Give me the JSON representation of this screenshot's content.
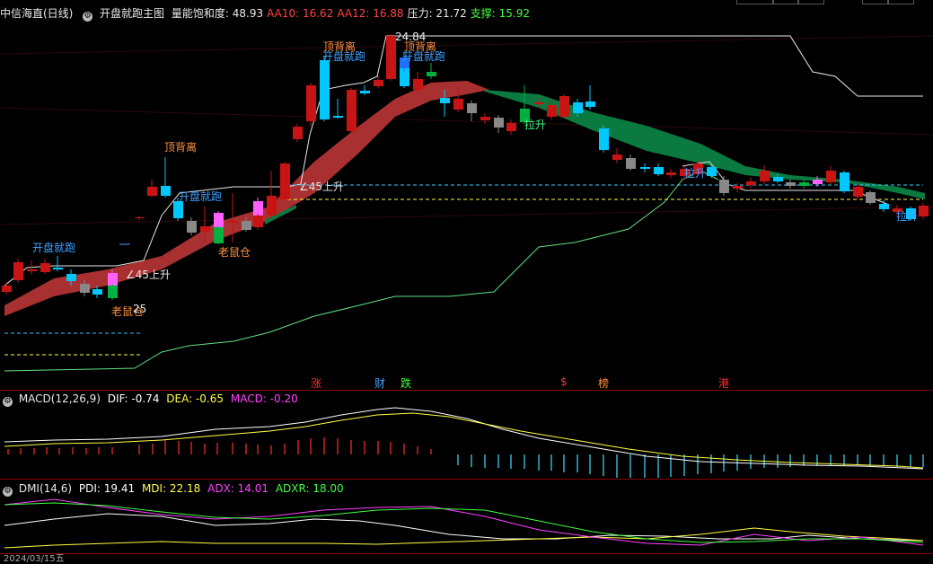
{
  "header": {
    "stock_name": "中信海直(日线)",
    "main_chart_name": "开盘就跑主图",
    "indicators": [
      {
        "label": "量能饱和度: 48.93",
        "color": "#e8e8e8"
      },
      {
        "label": "AA10: 16.62",
        "color": "#ff4040"
      },
      {
        "label": "AA12: 16.88",
        "color": "#ff4040"
      },
      {
        "label": "压力: 21.72",
        "color": "#e8e8e8"
      },
      {
        "label": "支撑: 15.92",
        "color": "#40ff40"
      }
    ]
  },
  "annotations": {
    "open_run_1": "开盘就跑",
    "open_run_2": "开盘就跑",
    "open_run_3": "开盘就跑",
    "open_run_4": "开盘就跑",
    "top_div_1": "顶背离",
    "top_div_2": "顶背离",
    "top_div_3": "顶背离",
    "rise45_1": "∠45上升",
    "rise45_2": "∠45上升",
    "rat_1": "老鼠仓",
    "rat_2": "老鼠仓",
    "pull_1": "拉升",
    "pull_2": "拉升",
    "pull_3": "拉升",
    "high_label": "24.84",
    "low_label": "25"
  },
  "events": [
    {
      "label": "涨",
      "color": "#ff3030"
    },
    {
      "label": "财",
      "color": "#40a0ff"
    },
    {
      "label": "跌",
      "color": "#40ff40"
    },
    {
      "label": "$",
      "color": "#ff3030"
    },
    {
      "label": "榜",
      "color": "#ff9040"
    },
    {
      "label": "港",
      "color": "#ff3030"
    }
  ],
  "macd": {
    "name": "MACD(12,26,9)",
    "dif": "DIF: -0.74",
    "dea": "DEA: -0.65",
    "macd": "MACD: -0.20",
    "colors": {
      "dif": "#ffffff",
      "dea": "#ffff40",
      "macd": "#ff40ff"
    }
  },
  "dmi": {
    "name": "DMI(14,6)",
    "pdi": "PDI: 19.41",
    "mdi": "MDI: 22.18",
    "adx": "ADX: 14.01",
    "adxr": "ADXR: 18.00",
    "colors": {
      "pdi": "#ffffff",
      "mdi": "#ffff40",
      "adx": "#ff40ff",
      "adxr": "#40ff40"
    }
  },
  "footer": {
    "date": "2024/03/15五"
  },
  "colors": {
    "up": "#c81414",
    "down": "#00c8ff",
    "band_up": "#a83030",
    "band_down": "#0a7a40",
    "separator": "#8a0000"
  }
}
